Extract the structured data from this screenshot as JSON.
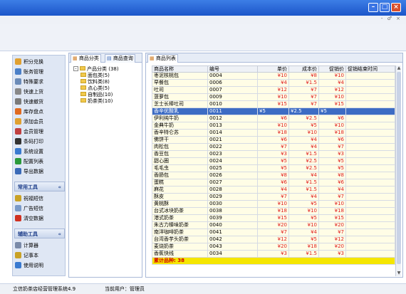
{
  "window": {
    "min_icon": "minimize-icon",
    "max_icon": "maximize-icon",
    "close_icon": "close-icon",
    "mdi_controls": "- ♂ ×"
  },
  "nav": {
    "items": [
      {
        "label": "积分兑换",
        "icon": "points-icon",
        "color": "#e0a030"
      },
      {
        "label": "账务管理",
        "icon": "ledger-icon",
        "color": "#4a7fc8"
      },
      {
        "label": "特殊要求",
        "icon": "special-request-icon",
        "color": "#6b8bb8"
      },
      {
        "label": "快速上货",
        "icon": "quick-stock-icon",
        "color": "#888888"
      },
      {
        "label": "快速撤货",
        "icon": "quick-remove-icon",
        "color": "#7a7a7a"
      },
      {
        "label": "库存盘点",
        "icon": "inventory-icon",
        "color": "#e06a20"
      },
      {
        "label": "添加会员",
        "icon": "add-member-icon",
        "color": "#e0a030"
      },
      {
        "label": "会员管理",
        "icon": "member-manage-icon",
        "color": "#c04040"
      },
      {
        "label": "条码打印",
        "icon": "barcode-icon",
        "color": "#333333"
      },
      {
        "label": "系统设置",
        "icon": "settings-icon",
        "color": "#3a7ad0"
      },
      {
        "label": "配置列表",
        "icon": "config-list-icon",
        "color": "#2a9a3a"
      },
      {
        "label": "导出数据",
        "icon": "export-icon",
        "color": "#3a6ab8"
      }
    ],
    "common_tools": {
      "header": "常用工具",
      "chevron": "«",
      "items": [
        {
          "label": "祝福短信",
          "icon": "sms-icon",
          "color": "#c9a227"
        },
        {
          "label": "广告短信",
          "icon": "ad-sms-icon",
          "color": "#7a9ac8"
        },
        {
          "label": "清空数据",
          "icon": "clear-data-icon",
          "color": "#d03020"
        }
      ]
    },
    "aux_tools": {
      "header": "辅助工具",
      "chevron": "«",
      "items": [
        {
          "label": "计算器",
          "icon": "calculator-icon",
          "color": "#7a8aa8"
        },
        {
          "label": "记事本",
          "icon": "notepad-icon",
          "color": "#c9a227"
        },
        {
          "label": "使用说明",
          "icon": "help-icon",
          "color": "#3a7ad0"
        }
      ]
    }
  },
  "categories": {
    "tabs": [
      "商品分类",
      "商品查询"
    ],
    "tree_root": "产品分类 (38)",
    "tree_expander": "-",
    "tree_children": [
      "面包类(5)",
      "饮料类(8)",
      "点心类(5)",
      "自制品(10)",
      "奶茶类(10)"
    ]
  },
  "list": {
    "tab": "商品列表",
    "columns": [
      "商品名称",
      "编号",
      "单价",
      "成本价",
      "促销价",
      "促销结束时间"
    ],
    "rows": [
      [
        "枣泥核桃包",
        "0004",
        "¥10",
        "¥8",
        "¥10",
        ""
      ],
      [
        "早餐包",
        "0006",
        "¥4",
        "¥1.5",
        "¥4",
        ""
      ],
      [
        "吐司",
        "0007",
        "¥12",
        "¥7",
        "¥12",
        ""
      ],
      [
        "菠萝包",
        "0009",
        "¥10",
        "¥7",
        "¥10",
        ""
      ],
      [
        "芝士长棒吐司",
        "0010",
        "¥15",
        "¥7",
        "¥15",
        ""
      ],
      [
        "香辛优酸乳",
        "0011",
        "¥5",
        "¥2.5",
        "¥5",
        ""
      ],
      [
        "伊利纯牛奶",
        "0012",
        "¥6",
        "¥2.5",
        "¥6",
        ""
      ],
      [
        "金典牛奶",
        "0013",
        "¥10",
        "¥5",
        "¥10",
        ""
      ],
      [
        "香辛特仑苏",
        "0014",
        "¥18",
        "¥10",
        "¥18",
        ""
      ],
      [
        "佛饼干",
        "0021",
        "¥6",
        "¥4",
        "¥6",
        ""
      ],
      [
        "肉松包",
        "0022",
        "¥7",
        "¥4",
        "¥7",
        ""
      ],
      [
        "香豆包",
        "0023",
        "¥3",
        "¥1.5",
        "¥3",
        ""
      ],
      [
        "甜心圈",
        "0024",
        "¥5",
        "¥2.5",
        "¥5",
        ""
      ],
      [
        "毛毛虫",
        "0025",
        "¥5",
        "¥2.5",
        "¥5",
        ""
      ],
      [
        "香肠包",
        "0026",
        "¥8",
        "¥4",
        "¥8",
        ""
      ],
      [
        "蛋糕",
        "0027",
        "¥6",
        "¥1.5",
        "¥6",
        ""
      ],
      [
        "麻花",
        "0028",
        "¥4",
        "¥1.5",
        "¥4",
        ""
      ],
      [
        "酥皮",
        "0029",
        "¥7",
        "¥4",
        "¥7",
        ""
      ],
      [
        "黄桃酥",
        "0030",
        "¥10",
        "¥5",
        "¥10",
        ""
      ],
      [
        "台式冰块奶茶",
        "0038",
        "¥18",
        "¥10",
        "¥18",
        ""
      ],
      [
        "港式奶茶",
        "0039",
        "¥15",
        "¥5",
        "¥15",
        ""
      ],
      [
        "朱古力榛味奶茶",
        "0040",
        "¥20",
        "¥10",
        "¥20",
        ""
      ],
      [
        "南洋咖啡奶茶",
        "0041",
        "¥7",
        "¥4",
        "¥7",
        ""
      ],
      [
        "台湾香芋头奶茶",
        "0042",
        "¥12",
        "¥5",
        "¥12",
        ""
      ],
      [
        "麦烧奶茶",
        "0043",
        "¥20",
        "¥18",
        "¥20",
        ""
      ],
      [
        "香蕉快线",
        "0034",
        "¥3",
        "¥1.5",
        "¥3",
        ""
      ]
    ],
    "selected_index": 5,
    "summary": "累计品种: 38",
    "scroll_up": "▲",
    "scroll_down": "▼"
  },
  "status": {
    "app": "立信奶茶店经营管理系统4.9",
    "user": "当前用户：管理员"
  }
}
